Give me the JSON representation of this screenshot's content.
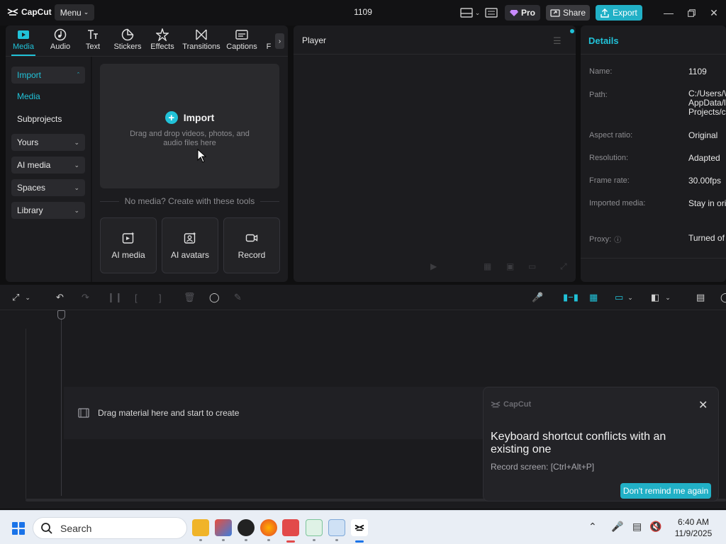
{
  "app": {
    "logo_text": "CapCut",
    "menu_label": "Menu",
    "project_title": "1109",
    "pro_label": "Pro",
    "share_label": "Share",
    "export_label": "Export",
    "accent_color": "#21c2d8"
  },
  "tabs": [
    {
      "label": "Media",
      "icon": "media-icon",
      "active": true
    },
    {
      "label": "Audio",
      "icon": "audio-icon"
    },
    {
      "label": "Text",
      "icon": "text-icon"
    },
    {
      "label": "Stickers",
      "icon": "stickers-icon"
    },
    {
      "label": "Effects",
      "icon": "effects-icon"
    },
    {
      "label": "Transitions",
      "icon": "transitions-icon"
    },
    {
      "label": "Captions",
      "icon": "captions-icon"
    },
    {
      "label": "F",
      "icon": "filters-icon"
    }
  ],
  "sidenav": {
    "import": "Import",
    "media": "Media",
    "subprojects": "Subprojects",
    "yours": "Yours",
    "ai_media": "AI media",
    "spaces": "Spaces",
    "library": "Library"
  },
  "import_area": {
    "title": "Import",
    "hint": "Drag and drop videos, photos, and audio files here"
  },
  "no_media_text": "No media? Create with these tools",
  "tools": [
    {
      "label": "AI media",
      "icon": "ai-media-icon"
    },
    {
      "label": "AI avatars",
      "icon": "ai-avatar-icon"
    },
    {
      "label": "Record",
      "icon": "record-icon"
    }
  ],
  "player": {
    "title": "Player"
  },
  "details": {
    "title": "Details",
    "rows": [
      {
        "label": "Name:",
        "value": "1109"
      },
      {
        "label": "Path:",
        "value": "C:/Users/\\ AppData/l Projects/c"
      },
      {
        "label": "Aspect ratio:",
        "value": "Original"
      },
      {
        "label": "Resolution:",
        "value": "Adapted"
      },
      {
        "label": "Frame rate:",
        "value": "30.00fps"
      },
      {
        "label": "Imported media:",
        "value": "Stay in ori"
      },
      {
        "label": "Proxy:",
        "value": "Turned of"
      }
    ]
  },
  "timeline": {
    "drag_hint": "Drag material here and start to create"
  },
  "toast": {
    "brand": "CapCut",
    "title": "Keyboard shortcut conflicts with an existing one",
    "subtitle": "Record screen: [Ctrl+Alt+P]",
    "button": "Don't remind me again"
  },
  "taskbar": {
    "search_placeholder": "Search",
    "time": "6:40 AM",
    "date": "11/9/2025"
  }
}
